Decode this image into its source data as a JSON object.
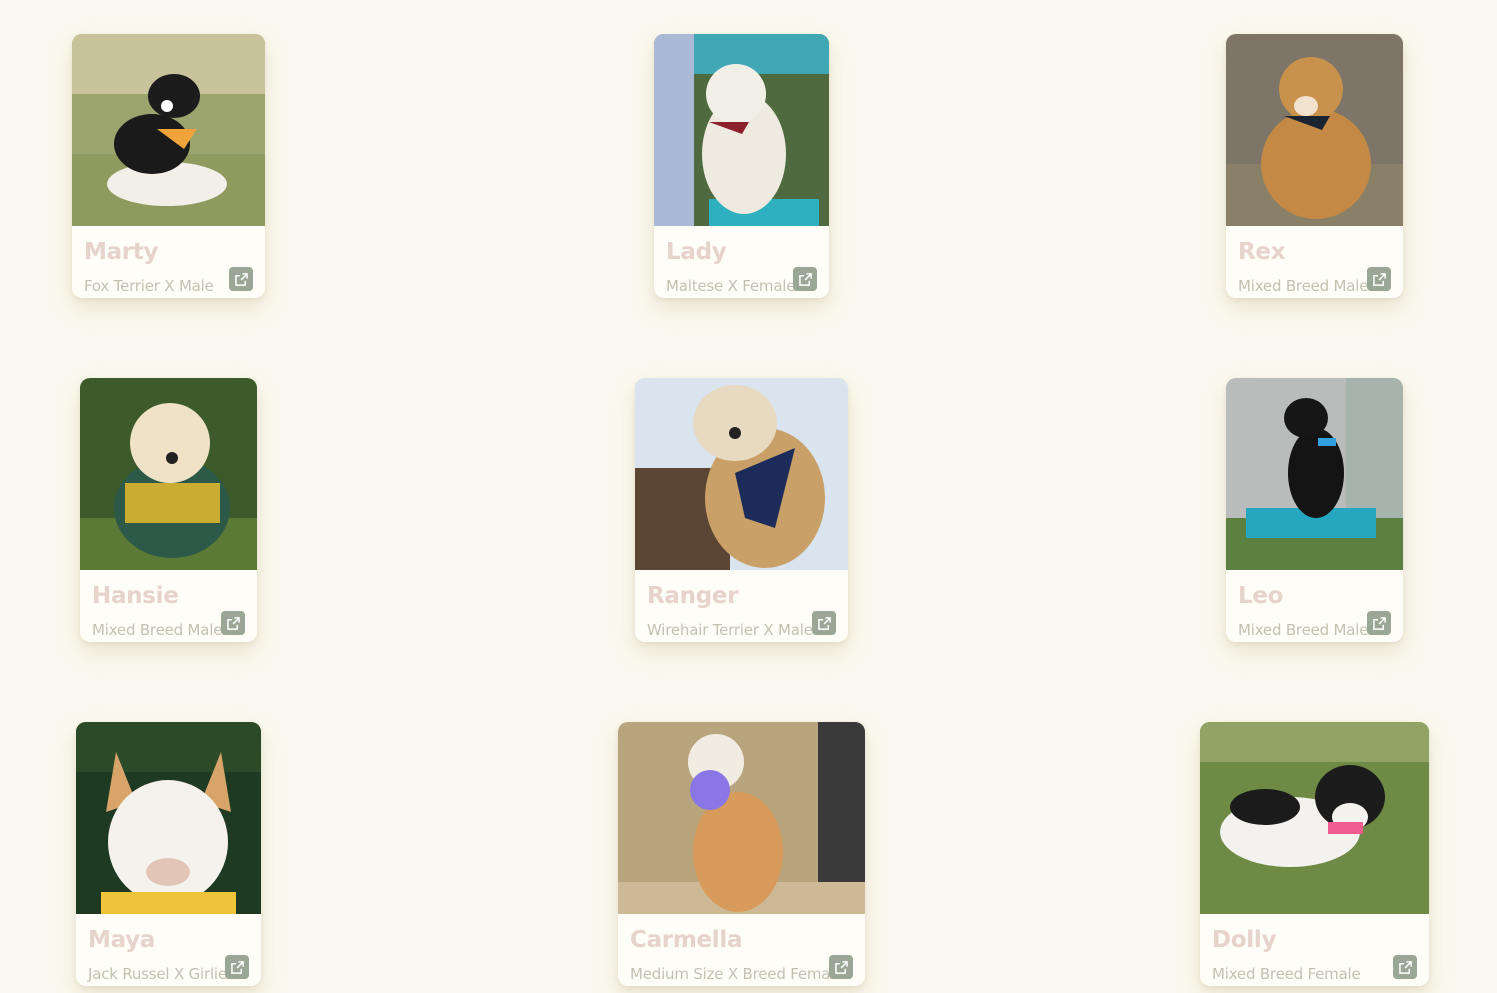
{
  "dogs": [
    {
      "name": "Marty",
      "breed": "Fox Terrier X Male",
      "link_icon": "external-link-icon"
    },
    {
      "name": "Lady",
      "breed": "Maltese X Female",
      "link_icon": "external-link-icon"
    },
    {
      "name": "Rex",
      "breed": "Mixed Breed Male",
      "link_icon": "external-link-icon"
    },
    {
      "name": "Hansie",
      "breed": "Mixed Breed Male",
      "link_icon": "external-link-icon"
    },
    {
      "name": "Ranger",
      "breed": "Wirehair Terrier X Male",
      "link_icon": "external-link-icon"
    },
    {
      "name": "Leo",
      "breed": "Mixed Breed Male",
      "link_icon": "external-link-icon"
    },
    {
      "name": "Maya",
      "breed": "Jack Russel X Girlie",
      "link_icon": "external-link-icon"
    },
    {
      "name": "Carmella",
      "breed": "Medium Size X Breed Femal",
      "link_icon": "external-link-icon"
    },
    {
      "name": "Dolly",
      "breed": "Mixed Breed Female",
      "link_icon": "external-link-icon"
    }
  ],
  "colors": {
    "background": "#fbf9ef",
    "card": "#fffdf7",
    "name_text": "#e6d3cb",
    "breed_text": "#c2c2b3",
    "link_button": "#9aa696"
  }
}
